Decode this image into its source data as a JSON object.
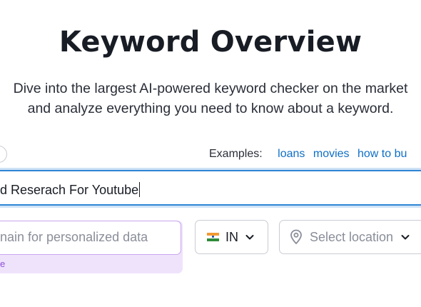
{
  "header": {
    "title": "Keyword Overview",
    "subtitle_line1": "Dive into the largest AI-powered keyword checker on the market",
    "subtitle_line2": "and analyze everything you need to know about a keyword."
  },
  "examples": {
    "label": "Examples:",
    "items": [
      "loans",
      "movies",
      "how to bu"
    ]
  },
  "keyword_input": {
    "value": "d Reserach For Youtube"
  },
  "domain_input": {
    "placeholder": "nain for personalized data",
    "note": "e"
  },
  "country_select": {
    "value": "IN",
    "flag": "india-flag"
  },
  "location_select": {
    "placeholder": "Select location"
  },
  "colors": {
    "accent_blue": "#2f86d6",
    "link_blue": "#0f6fc6",
    "purple": "#8f4fd6",
    "purple_bg": "#efe3fc"
  }
}
